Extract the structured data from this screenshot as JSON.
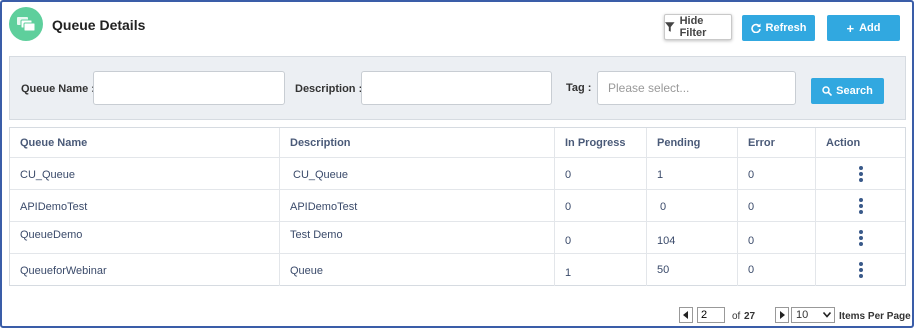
{
  "header": {
    "title": "Queue Details",
    "logo_icon": "queue-stack-icon",
    "hide_filter_label": "Hide Filter",
    "refresh_label": "Refresh",
    "add_label": "Add"
  },
  "filter": {
    "queue_name_label": "Queue Name :",
    "queue_name_value": "",
    "description_label": "Description :",
    "description_value": "",
    "tag_label": "Tag :",
    "tag_placeholder": "Please select...",
    "search_label": "Search"
  },
  "table": {
    "columns": [
      "Queue Name",
      "Description",
      "In Progress",
      "Pending",
      "Error",
      "Action"
    ],
    "rows": [
      {
        "name": "CU_Queue",
        "description": "CU_Queue",
        "in_progress": "0",
        "pending": "1",
        "error": "0"
      },
      {
        "name": "APIDemoTest",
        "description": "APIDemoTest",
        "in_progress": "0",
        "pending": "0",
        "error": "0"
      },
      {
        "name": "QueueDemo",
        "description": "Test Demo",
        "in_progress": "0",
        "pending": "104",
        "error": "0"
      },
      {
        "name": "QueueforWebinar",
        "description": "Queue",
        "in_progress": "1",
        "pending": "50",
        "error": "0"
      }
    ]
  },
  "pagination": {
    "current_page": "2",
    "of_label": "of",
    "total_pages": "27",
    "items_per_page_value": "10",
    "items_per_page_label": "Items Per Page"
  },
  "colors": {
    "accent": "#31a8e0",
    "logo": "#5ecf9c",
    "frame": "#3a5da8"
  }
}
